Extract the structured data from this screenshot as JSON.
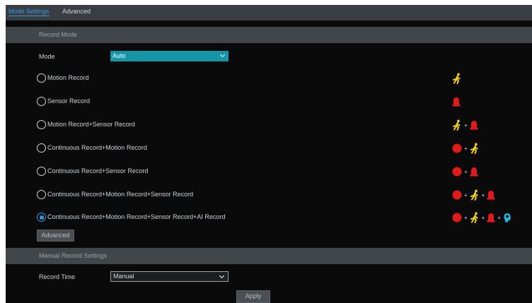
{
  "tabs": [
    {
      "label": "Mode Settings",
      "active": true
    },
    {
      "label": "Advanced",
      "active": false
    }
  ],
  "record_mode": {
    "header": "Record Mode",
    "mode_label": "Mode",
    "mode_value": "Auto",
    "options": [
      {
        "label": "Motion Record",
        "checked": false,
        "icons": [
          "motion-icon"
        ]
      },
      {
        "label": "Sensor Record",
        "checked": false,
        "icons": [
          "sensor-alarm-icon"
        ]
      },
      {
        "label": "Motion Record+Sensor Record",
        "checked": false,
        "icons": [
          "motion-icon",
          "sensor-alarm-icon"
        ]
      },
      {
        "label": "Continuous Record+Motion Record",
        "checked": false,
        "icons": [
          "continuous-record-icon",
          "motion-icon"
        ]
      },
      {
        "label": "Continuous Record+Sensor Record",
        "checked": false,
        "icons": [
          "continuous-record-icon",
          "sensor-alarm-icon"
        ]
      },
      {
        "label": "Continuous Record+Motion Record+Sensor Record",
        "checked": false,
        "icons": [
          "continuous-record-icon",
          "motion-icon",
          "sensor-alarm-icon"
        ]
      },
      {
        "label": "Continuous Record+Motion Record+Sensor Record+AI Record",
        "checked": true,
        "icons": [
          "continuous-record-icon",
          "motion-icon",
          "sensor-alarm-icon",
          "ai-head-icon"
        ]
      }
    ],
    "plus_sign": "+",
    "advanced_button": "Advanced"
  },
  "manual_record": {
    "header": "Manual Record Settings",
    "record_time_label": "Record Time",
    "record_time_value": "Manual"
  },
  "apply_button": "Apply",
  "colors": {
    "accent_blue": "#2f9be8",
    "select_teal": "#1496a8",
    "motion_yellow": "#f2d21b",
    "alarm_red": "#e01b1b",
    "ai_cyan": "#1fb8e0"
  }
}
